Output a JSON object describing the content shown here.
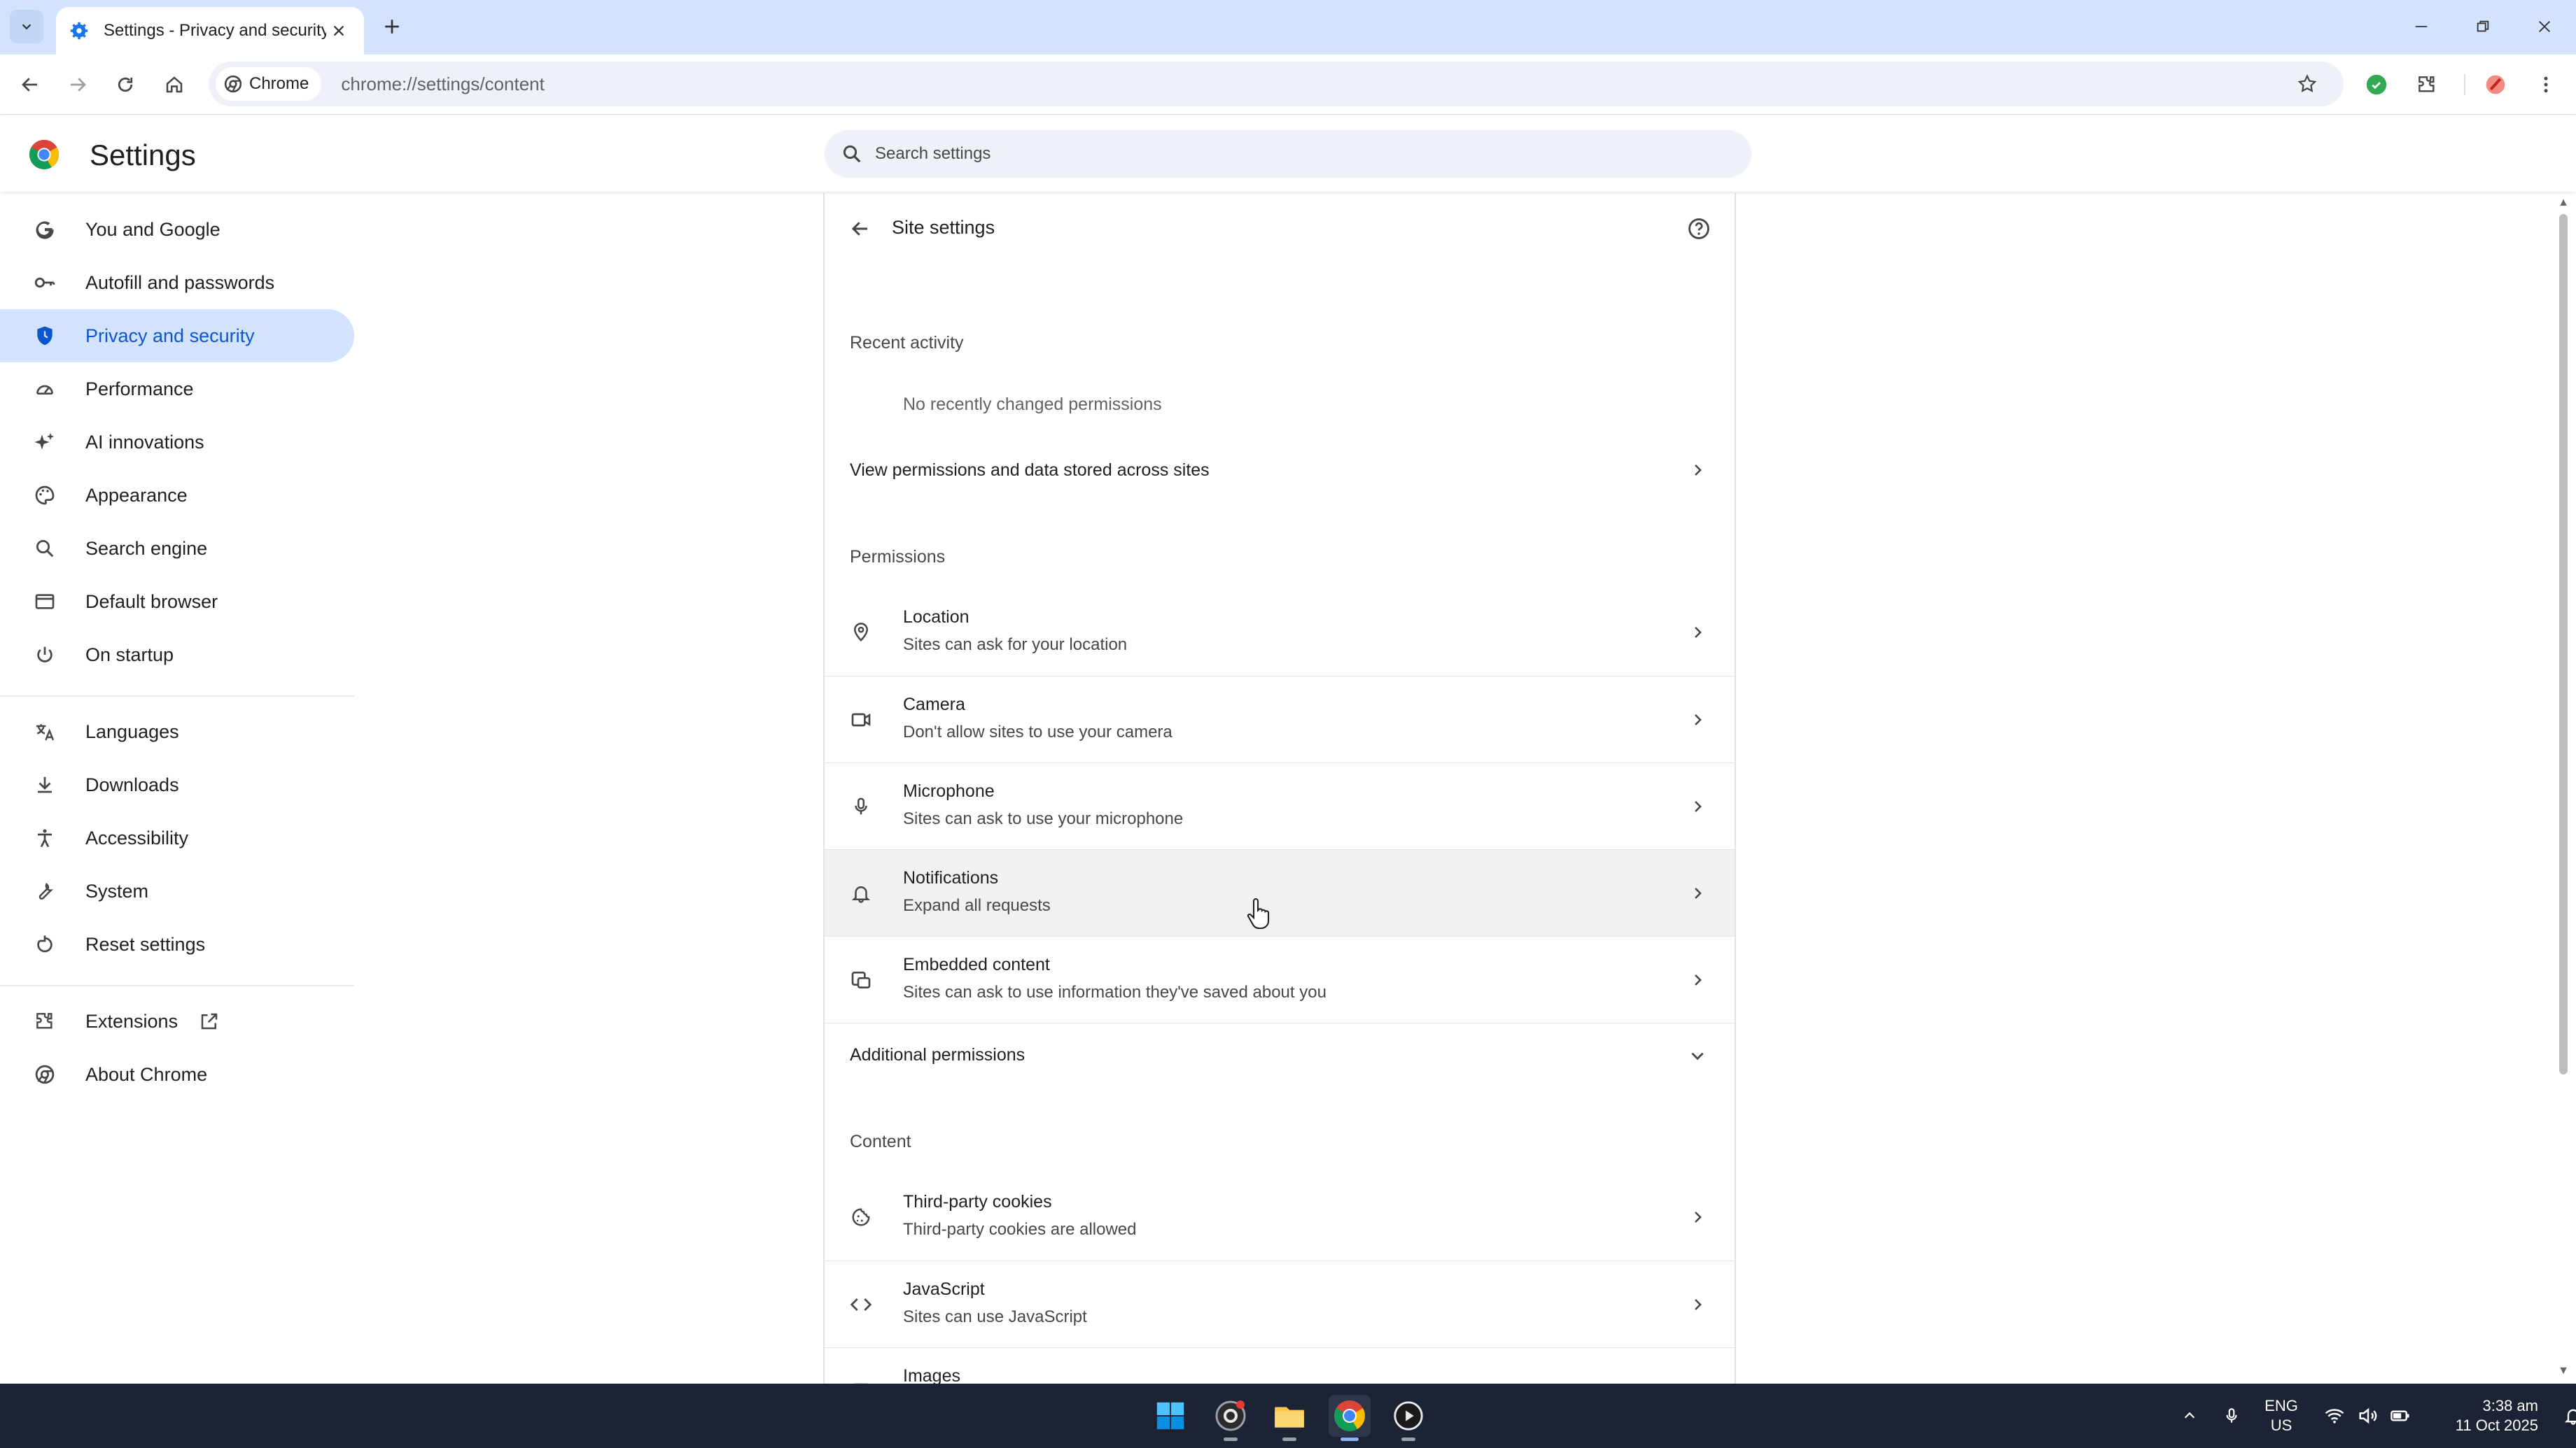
{
  "browser": {
    "tab": {
      "title": "Settings - Privacy and security"
    },
    "omnibox": {
      "chip_label": "Chrome",
      "url": "chrome://settings/content"
    }
  },
  "settings": {
    "title": "Settings",
    "search": {
      "placeholder": "Search settings"
    }
  },
  "sidebar": {
    "items": [
      {
        "label": "You and Google",
        "icon": "google-icon"
      },
      {
        "label": "Autofill and passwords",
        "icon": "key-icon"
      },
      {
        "label": "Privacy and security",
        "icon": "shield-icon",
        "active": true
      },
      {
        "label": "Performance",
        "icon": "speedometer-icon"
      },
      {
        "label": "AI innovations",
        "icon": "sparkle-icon"
      },
      {
        "label": "Appearance",
        "icon": "palette-icon"
      },
      {
        "label": "Search engine",
        "icon": "search-icon"
      },
      {
        "label": "Default browser",
        "icon": "browser-window-icon"
      },
      {
        "label": "On startup",
        "icon": "power-icon"
      },
      {
        "label": "Languages",
        "icon": "translate-icon"
      },
      {
        "label": "Downloads",
        "icon": "download-icon"
      },
      {
        "label": "Accessibility",
        "icon": "accessibility-icon"
      },
      {
        "label": "System",
        "icon": "wrench-icon"
      },
      {
        "label": "Reset settings",
        "icon": "reset-icon"
      },
      {
        "label": "Extensions",
        "icon": "puzzle-icon"
      },
      {
        "label": "About Chrome",
        "icon": "chrome-icon"
      }
    ]
  },
  "site_settings": {
    "title": "Site settings",
    "recent_activity": {
      "heading": "Recent activity",
      "empty_text": "No recently changed permissions"
    },
    "view_permissions_label": "View permissions and data stored across sites",
    "permissions": {
      "heading": "Permissions",
      "items": [
        {
          "title": "Location",
          "subtitle": "Sites can ask for your location",
          "icon": "location-pin-icon"
        },
        {
          "title": "Camera",
          "subtitle": "Don't allow sites to use your camera",
          "icon": "camera-icon"
        },
        {
          "title": "Microphone",
          "subtitle": "Sites can ask to use your microphone",
          "icon": "microphone-icon"
        },
        {
          "title": "Notifications",
          "subtitle": "Expand all requests",
          "icon": "bell-icon"
        },
        {
          "title": "Embedded content",
          "subtitle": "Sites can ask to use information they've saved about you",
          "icon": "embedded-content-icon"
        }
      ],
      "additional_label": "Additional permissions"
    },
    "content": {
      "heading": "Content",
      "items": [
        {
          "title": "Third-party cookies",
          "subtitle": "Third-party cookies are allowed",
          "icon": "cookie-icon"
        },
        {
          "title": "JavaScript",
          "subtitle": "Sites can use JavaScript",
          "icon": "code-icon"
        },
        {
          "title": "Images",
          "subtitle": "",
          "icon": "image-icon"
        }
      ]
    }
  },
  "taskbar": {
    "language": {
      "line1": "ENG",
      "line2": "US"
    },
    "clock": {
      "time": "3:38 am",
      "date": "11 Oct 2025"
    }
  },
  "colors": {
    "accent": "#0b57d0",
    "active_nav_bg": "#d3e3fd",
    "tabstrip_bg": "#d3e3fd",
    "taskbar_bg": "#1c2334"
  }
}
